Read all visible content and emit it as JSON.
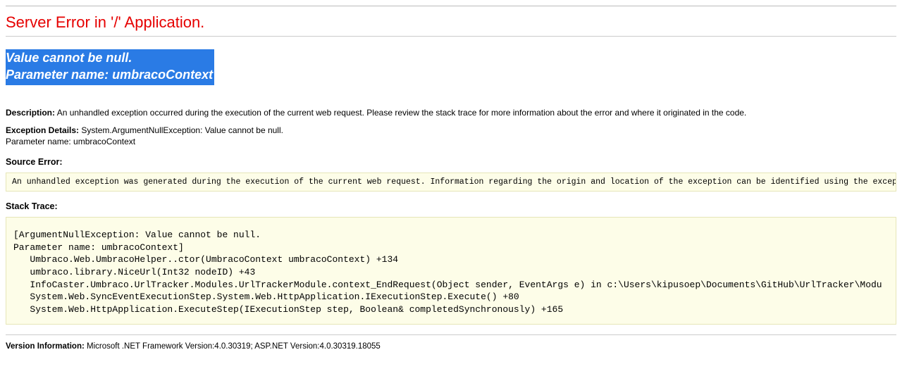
{
  "title": "Server Error in '/' Application.",
  "exception_message_line1": "Value cannot be null.",
  "exception_message_line2": "Parameter name: umbracoContext",
  "description": {
    "label": "Description:",
    "text": " An unhandled exception occurred during the execution of the current web request. Please review the stack trace for more information about the error and where it originated in the code."
  },
  "exception_details": {
    "label": "Exception Details:",
    "text_line1": " System.ArgumentNullException: Value cannot be null.",
    "text_line2": "Parameter name: umbracoContext"
  },
  "source_error": {
    "label": "Source Error:",
    "box": "An unhandled exception was generated during the execution of the current web request. Information regarding the origin and location of the exception can be identified using the exception stack trace below."
  },
  "stack_trace": {
    "label": "Stack Trace:",
    "box": "[ArgumentNullException: Value cannot be null.\nParameter name: umbracoContext]\n   Umbraco.Web.UmbracoHelper..ctor(UmbracoContext umbracoContext) +134\n   umbraco.library.NiceUrl(Int32 nodeID) +43\n   InfoCaster.Umbraco.UrlTracker.Modules.UrlTrackerModule.context_EndRequest(Object sender, EventArgs e) in c:\\Users\\kipusoep\\Documents\\GitHub\\UrlTracker\\Modu\n   System.Web.SyncEventExecutionStep.System.Web.HttpApplication.IExecutionStep.Execute() +80\n   System.Web.HttpApplication.ExecuteStep(IExecutionStep step, Boolean& completedSynchronously) +165"
  },
  "version": {
    "label": "Version Information:",
    "text": " Microsoft .NET Framework Version:4.0.30319; ASP.NET Version:4.0.30319.18055"
  }
}
